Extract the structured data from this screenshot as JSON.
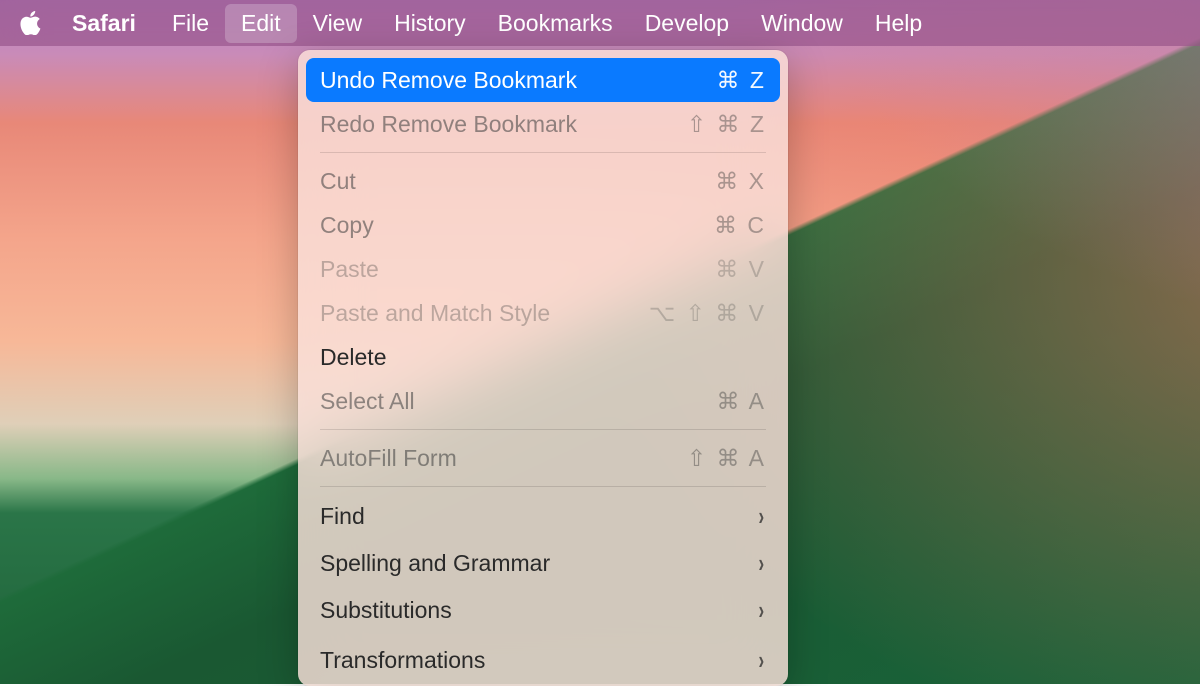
{
  "menubar": {
    "app_name": "Safari",
    "items": [
      "File",
      "Edit",
      "View",
      "History",
      "Bookmarks",
      "Develop",
      "Window",
      "Help"
    ],
    "active_index": 1
  },
  "dropdown": {
    "sections": [
      [
        {
          "label": "Undo Remove Bookmark",
          "shortcut": "⌘ Z",
          "state": "highlighted"
        },
        {
          "label": "Redo Remove Bookmark",
          "shortcut": "⇧ ⌘ Z",
          "state": "inactive"
        }
      ],
      [
        {
          "label": "Cut",
          "shortcut": "⌘ X",
          "state": "inactive"
        },
        {
          "label": "Copy",
          "shortcut": "⌘ C",
          "state": "inactive"
        },
        {
          "label": "Paste",
          "shortcut": "⌘ V",
          "state": "disabled"
        },
        {
          "label": "Paste and Match Style",
          "shortcut": "⌥ ⇧ ⌘ V",
          "state": "disabled"
        },
        {
          "label": "Delete",
          "shortcut": "",
          "state": "normal"
        },
        {
          "label": "Select All",
          "shortcut": "⌘ A",
          "state": "inactive"
        }
      ],
      [
        {
          "label": "AutoFill Form",
          "shortcut": "⇧ ⌘ A",
          "state": "inactive"
        }
      ],
      [
        {
          "label": "Find",
          "submenu": true,
          "state": "normal"
        },
        {
          "label": "Spelling and Grammar",
          "submenu": true,
          "state": "normal"
        },
        {
          "label": "Substitutions",
          "submenu": true,
          "state": "normal"
        },
        {
          "label": "Transformations",
          "submenu": true,
          "state": "normal"
        }
      ]
    ]
  }
}
